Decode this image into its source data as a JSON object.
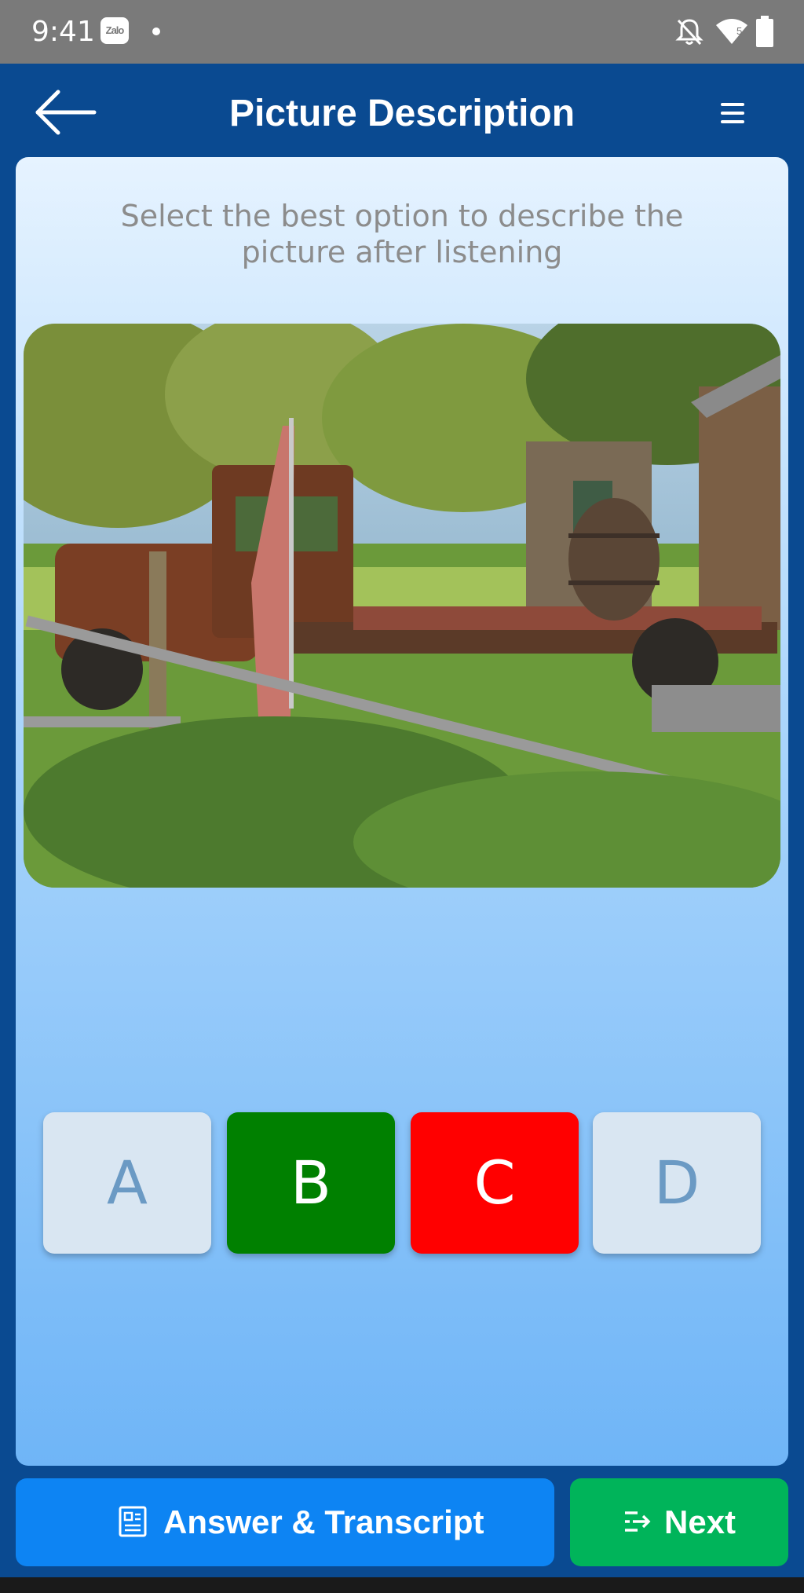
{
  "status_bar": {
    "time": "9:41",
    "zalo_label": "Zalo",
    "wifi_badge": "5",
    "icons": [
      "zalo-icon",
      "dot-icon",
      "bell-off-icon",
      "wifi-icon",
      "battery-icon"
    ]
  },
  "header": {
    "title": "Picture Description",
    "back_icon": "arrow-left-icon",
    "menu_icon": "menu-icon"
  },
  "main": {
    "instruction": "Select the best option to describe the picture after listening",
    "options": [
      {
        "label": "A",
        "state": "default"
      },
      {
        "label": "B",
        "state": "correct"
      },
      {
        "label": "C",
        "state": "incorrect"
      },
      {
        "label": "D",
        "state": "default"
      }
    ]
  },
  "footer": {
    "answer_label": "Answer & Transcript",
    "next_label": "Next"
  },
  "colors": {
    "header_bg": "#0a4a91",
    "correct": "#008000",
    "incorrect": "#ff0000",
    "answer_button": "#0d84f3",
    "next_button": "#00b45a"
  }
}
